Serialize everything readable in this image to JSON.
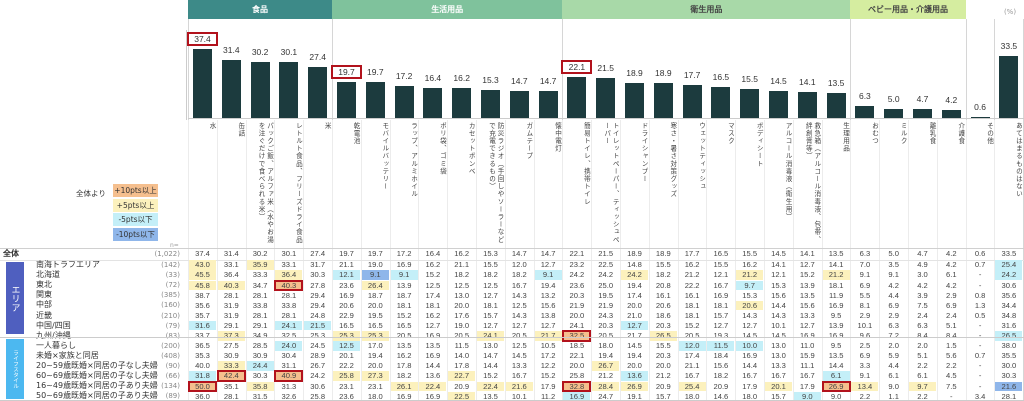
{
  "groups": [
    {
      "label": "食品",
      "color": "#3d8a88",
      "text_color": "#ffffff",
      "start": 0,
      "end": 4
    },
    {
      "label": "生活用品",
      "color": "#7fc29c",
      "text_color": "#ffffff",
      "start": 5,
      "end": 12
    },
    {
      "label": "衛生用品",
      "color": "#a8d9a8",
      "text_color": "#444444",
      "start": 13,
      "end": 22
    },
    {
      "label": "ベビー用品・介護用品",
      "color": "#d5eda0",
      "text_color": "#444444",
      "start": 23,
      "end": 26
    }
  ],
  "unit_label": "(%)",
  "categories": [
    "水",
    "缶詰",
    "パックご飯、アルファ米（水やお湯を注ぐだけで食べられる米）",
    "レトルト食品、フリーズドライ食品",
    "米",
    "乾電池",
    "モバイルバッテリー",
    "ラップ、アルミホイル",
    "ポリ袋、ゴミ袋",
    "カセットボンベ",
    "防災ラジオ（手回しやソーラーなどで充電できるもの）",
    "ガムテープ",
    "懐中電灯",
    "簡易トイレ、携帯トイレ",
    "トイレットペーパー、ティッシュペーパー",
    "ドライシャンプー",
    "寒さ・暑さ対策グッズ",
    "ウェットティッシュ",
    "マスク",
    "ボディシート",
    "アルコール消毒液（衛生用）",
    "救急箱（アルコール消毒液、包帯、絆創膏等）",
    "生理用品",
    "おむつ",
    "ミルク",
    "離乳食",
    "介護食",
    "その他",
    "あてはまるものはない"
  ],
  "chart_data": {
    "type": "bar",
    "title": "",
    "ylabel": "(%)",
    "ylim": [
      0,
      40
    ],
    "values": [
      37.4,
      31.4,
      30.2,
      30.1,
      27.4,
      19.7,
      19.7,
      17.2,
      16.4,
      16.2,
      15.3,
      14.7,
      14.7,
      22.1,
      21.5,
      18.9,
      18.9,
      17.7,
      16.5,
      15.5,
      14.5,
      14.1,
      13.5,
      6.3,
      5.0,
      4.7,
      4.2,
      0.6,
      33.5
    ],
    "labels": [
      "37.4",
      "31.4",
      "30.2",
      "30.1",
      "27.4",
      "19.7",
      "19.7",
      "17.2",
      "16.4",
      "16.2",
      "15.3",
      "14.7",
      "14.7",
      "22.1",
      "21.5",
      "18.9",
      "18.9",
      "17.7",
      "16.5",
      "15.5",
      "14.5",
      "14.1",
      "13.5",
      "6.3",
      "5.0",
      "4.7",
      "4.2",
      "0.6",
      "33.5"
    ],
    "boxed": [
      0,
      5,
      13
    ]
  },
  "legend": {
    "title": "全体より",
    "items": [
      {
        "label": "+10pts以上",
        "color": "#f5bf8e"
      },
      {
        "label": "+5pts以上",
        "color": "#fcf1bd"
      },
      {
        "label": "-5pts以下",
        "color": "#c4eff8"
      },
      {
        "label": "-10pts以下",
        "color": "#8fb6ea"
      }
    ],
    "n_label": "n="
  },
  "bands": [
    {
      "label": "エリア",
      "color": "#4f5fbf"
    },
    {
      "label": "ライフスタイル",
      "color": "#4cb8f0"
    }
  ],
  "table": {
    "total": {
      "label": "全体",
      "n": "(1,022)",
      "values": [
        "37.4",
        "31.4",
        "30.2",
        "30.1",
        "27.4",
        "19.7",
        "19.7",
        "17.2",
        "16.4",
        "16.2",
        "15.3",
        "14.7",
        "14.7",
        "22.1",
        "21.5",
        "18.9",
        "18.9",
        "17.7",
        "16.5",
        "15.5",
        "14.5",
        "14.1",
        "13.5",
        "6.3",
        "5.0",
        "4.7",
        "4.2",
        "0.6",
        "33.5"
      ],
      "hl": {},
      "box": []
    },
    "rows": [
      {
        "label": "南海トラフエリア",
        "n": "(142)",
        "values": [
          "43.0",
          "33.1",
          "35.9",
          "33.1",
          "31.7",
          "21.1",
          "19.0",
          "16.9",
          "16.2",
          "21.1",
          "15.5",
          "12.0",
          "12.7",
          "23.2",
          "22.5",
          "14.8",
          "15.5",
          "16.2",
          "15.5",
          "16.2",
          "14.1",
          "12.7",
          "14.1",
          "7.0",
          "3.5",
          "4.9",
          "4.2",
          "0.7",
          "25.4"
        ],
        "hl": {
          "0": "p5",
          "2": "p5",
          "28": "m5"
        },
        "box": []
      },
      {
        "label": "北海道",
        "n": "(33)",
        "values": [
          "45.5",
          "36.4",
          "33.3",
          "36.4",
          "30.3",
          "12.1",
          "9.1",
          "9.1",
          "15.2",
          "18.2",
          "18.2",
          "18.2",
          "9.1",
          "24.2",
          "24.2",
          "24.2",
          "18.2",
          "21.2",
          "12.1",
          "21.2",
          "12.1",
          "15.2",
          "21.2",
          "9.1",
          "9.1",
          "3.0",
          "6.1",
          "-",
          "24.2"
        ],
        "hl": {
          "0": "p5",
          "3": "p5",
          "5": "m5",
          "6": "m10",
          "7": "m5",
          "12": "m5",
          "15": "p5",
          "19": "p5",
          "22": "p5",
          "28": "m5"
        },
        "box": []
      },
      {
        "label": "東北",
        "n": "(72)",
        "values": [
          "45.8",
          "40.3",
          "34.7",
          "40.3",
          "27.8",
          "23.6",
          "26.4",
          "13.9",
          "12.5",
          "12.5",
          "12.5",
          "16.7",
          "19.4",
          "23.6",
          "25.0",
          "19.4",
          "20.8",
          "22.2",
          "16.7",
          "9.7",
          "15.3",
          "13.9",
          "18.1",
          "6.9",
          "4.2",
          "4.2",
          "4.2",
          "-",
          "30.6"
        ],
        "hl": {
          "0": "p5",
          "1": "p5",
          "3": "p10",
          "6": "p5",
          "19": "m5"
        },
        "box": [
          3
        ]
      },
      {
        "label": "関東",
        "n": "(385)",
        "values": [
          "38.7",
          "28.1",
          "28.1",
          "28.1",
          "29.4",
          "16.9",
          "18.7",
          "18.7",
          "17.4",
          "13.0",
          "12.7",
          "14.3",
          "13.2",
          "20.3",
          "19.5",
          "17.4",
          "16.1",
          "16.1",
          "16.9",
          "15.3",
          "15.6",
          "13.5",
          "11.9",
          "5.5",
          "4.4",
          "3.9",
          "2.9",
          "0.8",
          "35.6"
        ],
        "hl": {},
        "box": []
      },
      {
        "label": "中部",
        "n": "(160)",
        "values": [
          "35.6",
          "31.9",
          "33.8",
          "33.8",
          "29.4",
          "20.6",
          "20.0",
          "18.1",
          "18.1",
          "20.0",
          "18.1",
          "12.5",
          "15.6",
          "21.9",
          "21.9",
          "20.0",
          "20.6",
          "18.1",
          "18.1",
          "20.6",
          "14.4",
          "15.6",
          "16.9",
          "8.1",
          "6.9",
          "7.5",
          "6.9",
          "1.3",
          "34.4"
        ],
        "hl": {
          "19": "p5"
        },
        "box": []
      },
      {
        "label": "近畿",
        "n": "(210)",
        "values": [
          "35.7",
          "31.9",
          "28.1",
          "28.1",
          "24.8",
          "22.9",
          "19.5",
          "15.2",
          "16.2",
          "17.6",
          "15.7",
          "14.3",
          "13.8",
          "20.0",
          "24.3",
          "21.0",
          "18.6",
          "18.1",
          "15.7",
          "14.3",
          "14.3",
          "13.3",
          "9.5",
          "2.9",
          "2.9",
          "2.4",
          "2.4",
          "0.5",
          "34.8"
        ],
        "hl": {},
        "box": []
      },
      {
        "label": "中国/四国",
        "n": "(79)",
        "values": [
          "31.6",
          "29.1",
          "29.1",
          "24.1",
          "21.5",
          "16.5",
          "16.5",
          "16.5",
          "12.7",
          "19.0",
          "12.7",
          "12.7",
          "12.7",
          "24.1",
          "20.3",
          "12.7",
          "20.3",
          "15.2",
          "12.7",
          "12.7",
          "10.1",
          "12.7",
          "13.9",
          "10.1",
          "6.3",
          "6.3",
          "5.1",
          "-",
          "31.6"
        ],
        "hl": {
          "0": "m5",
          "3": "m5",
          "4": "m5",
          "15": "m5"
        },
        "box": []
      },
      {
        "label": "九州/沖縄",
        "n": "(83)",
        "values": [
          "33.7",
          "37.3",
          "34.9",
          "32.5",
          "25.3",
          "25.3",
          "25.3",
          "20.5",
          "16.9",
          "20.5",
          "24.1",
          "20.5",
          "21.7",
          "32.5",
          "20.5",
          "21.7",
          "26.5",
          "20.5",
          "19.3",
          "14.5",
          "14.5",
          "16.9",
          "16.9",
          "9.6",
          "7.2",
          "8.4",
          "8.4",
          "-",
          "26.5"
        ],
        "hl": {
          "1": "p5",
          "5": "p5",
          "6": "p5",
          "10": "p5",
          "12": "p5",
          "13": "p10",
          "16": "p5",
          "28": "m5"
        },
        "box": [
          13
        ]
      },
      {
        "label": "一人暮らし",
        "n": "(200)",
        "values": [
          "36.5",
          "27.5",
          "28.5",
          "24.0",
          "24.5",
          "12.5",
          "17.0",
          "13.5",
          "13.5",
          "11.5",
          "13.0",
          "12.5",
          "10.5",
          "18.5",
          "18.0",
          "14.5",
          "15.5",
          "12.0",
          "11.5",
          "10.0",
          "13.0",
          "11.0",
          "9.5",
          "2.5",
          "2.0",
          "2.0",
          "1.5",
          "-",
          "38.0"
        ],
        "hl": {
          "3": "m5",
          "5": "m5",
          "17": "m5",
          "18": "m5",
          "19": "m5"
        },
        "box": []
      },
      {
        "label": "未婚×家族と同居",
        "n": "(408)",
        "values": [
          "35.3",
          "30.9",
          "30.9",
          "30.4",
          "28.9",
          "20.1",
          "19.4",
          "16.2",
          "16.9",
          "14.0",
          "14.7",
          "14.5",
          "17.2",
          "22.1",
          "19.4",
          "19.4",
          "20.3",
          "17.4",
          "18.4",
          "16.9",
          "13.0",
          "15.9",
          "13.5",
          "6.9",
          "5.9",
          "5.1",
          "5.6",
          "0.7",
          "35.5"
        ],
        "hl": {},
        "box": []
      },
      {
        "label": "20~59歳既婚×同居の子なし夫婦",
        "n": "(90)",
        "values": [
          "40.0",
          "33.3",
          "24.4",
          "31.1",
          "26.7",
          "22.2",
          "20.0",
          "17.8",
          "14.4",
          "17.8",
          "14.4",
          "13.3",
          "12.2",
          "20.0",
          "26.7",
          "20.0",
          "20.0",
          "21.1",
          "15.6",
          "14.4",
          "13.3",
          "11.1",
          "14.4",
          "3.3",
          "4.4",
          "2.2",
          "2.2",
          "-",
          "30.0"
        ],
        "hl": {
          "1": "p5",
          "2": "m5",
          "14": "p5"
        },
        "box": []
      },
      {
        "label": "60~69歳既婚×同居の子なし夫婦",
        "n": "(66)",
        "values": [
          "31.8",
          "42.4",
          "30.3",
          "40.9",
          "24.2",
          "25.8",
          "27.3",
          "18.2",
          "13.6",
          "22.7",
          "15.2",
          "16.7",
          "15.2",
          "25.8",
          "21.2",
          "13.6",
          "21.2",
          "16.7",
          "18.2",
          "16.7",
          "16.7",
          "16.7",
          "6.1",
          "9.1",
          "6.1",
          "6.1",
          "4.5",
          "-",
          "30.3"
        ],
        "hl": {
          "0": "m5",
          "1": "p10",
          "3": "p10",
          "5": "p5",
          "6": "p5",
          "9": "p5",
          "15": "m5",
          "22": "m5"
        },
        "box": [
          1,
          3
        ]
      },
      {
        "label": "16~49歳既婚×同居の子あり夫婦",
        "n": "(134)",
        "values": [
          "50.0",
          "35.1",
          "35.8",
          "31.3",
          "30.6",
          "23.1",
          "23.1",
          "26.1",
          "22.4",
          "20.9",
          "22.4",
          "21.6",
          "17.9",
          "32.8",
          "28.4",
          "26.9",
          "20.9",
          "25.4",
          "20.9",
          "17.9",
          "20.1",
          "17.9",
          "26.9",
          "13.4",
          "9.0",
          "9.7",
          "7.5",
          "-",
          "21.6"
        ],
        "hl": {
          "0": "p10",
          "2": "p5",
          "7": "p5",
          "8": "p5",
          "10": "p5",
          "11": "p5",
          "13": "p10",
          "14": "p5",
          "15": "p5",
          "17": "p5",
          "20": "p5",
          "22": "p10",
          "23": "p5",
          "25": "p5",
          "28": "m10"
        },
        "box": [
          0,
          13,
          22
        ]
      },
      {
        "label": "50~69歳既婚×同居の子あり夫婦",
        "n": "(89)",
        "values": [
          "36.0",
          "28.1",
          "31.5",
          "32.6",
          "25.8",
          "23.6",
          "18.0",
          "16.9",
          "16.9",
          "22.5",
          "13.5",
          "10.1",
          "11.2",
          "16.9",
          "24.7",
          "19.1",
          "15.7",
          "18.0",
          "14.6",
          "18.0",
          "15.7",
          "9.0",
          "9.0",
          "2.2",
          "1.1",
          "2.2",
          "-",
          "3.4",
          "28.1"
        ],
        "hl": {
          "9": "p5",
          "13": "m5",
          "21": "m5"
        },
        "box": []
      }
    ]
  }
}
